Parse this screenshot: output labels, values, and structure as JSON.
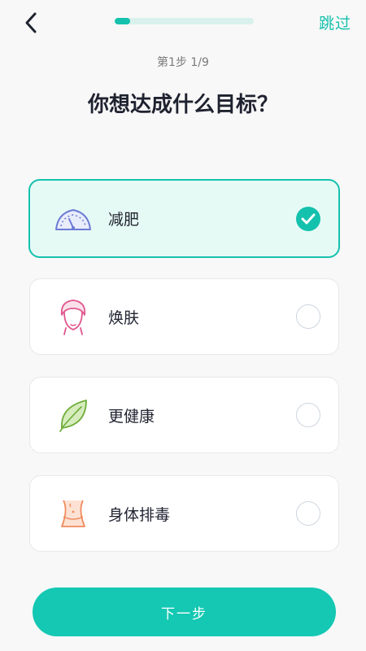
{
  "header": {
    "back_icon": "chevron-left-icon",
    "progress": 0.111,
    "skip_label": "跳过"
  },
  "step_text": "第1步  1/9",
  "title": "你想达成什么目标？",
  "options": [
    {
      "label": "减肥",
      "icon": "scale-icon",
      "selected": true
    },
    {
      "label": "焕肤",
      "icon": "face-towel-icon",
      "selected": false
    },
    {
      "label": "更健康",
      "icon": "leaf-icon",
      "selected": false
    },
    {
      "label": "身体排毒",
      "icon": "waist-icon",
      "selected": false
    }
  ],
  "next_label": "下一步",
  "colors": {
    "accent": "#14c1ad",
    "selected_bg": "#e6faf5",
    "text": "#1f2330"
  }
}
